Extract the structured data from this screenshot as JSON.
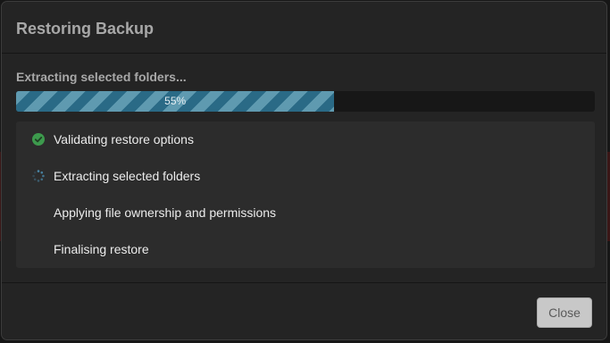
{
  "dialog": {
    "title": "Restoring Backup",
    "status_text": "Extracting selected folders...",
    "progress": {
      "percent": 55,
      "label": "55%"
    },
    "steps": [
      {
        "label": "Validating restore options",
        "state": "done",
        "icon": "check-circle-icon"
      },
      {
        "label": "Extracting selected folders",
        "state": "in-progress",
        "icon": "spinner-icon"
      },
      {
        "label": "Applying file ownership and permissions",
        "state": "pending",
        "icon": ""
      },
      {
        "label": "Finalising restore",
        "state": "pending",
        "icon": ""
      }
    ],
    "close_label": "Close"
  },
  "colors": {
    "success": "#3d9a4d",
    "spinner": "#4a87a8",
    "progress_fill": "#2c6f8c"
  }
}
